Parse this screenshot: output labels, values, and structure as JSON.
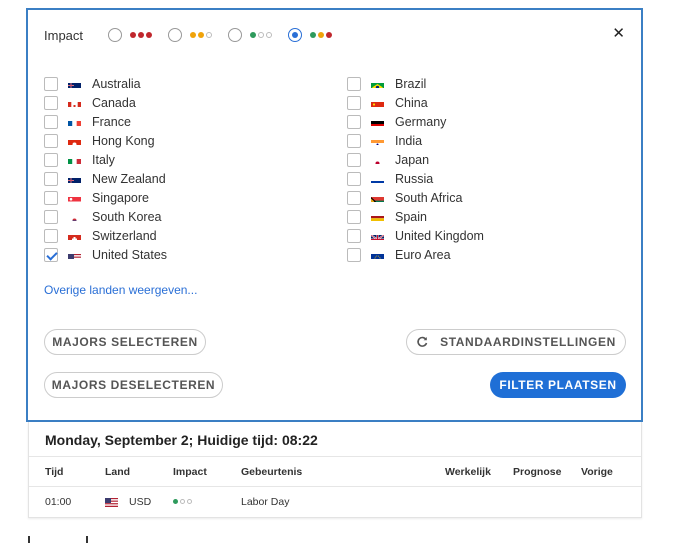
{
  "impact": {
    "label": "Impact",
    "options": [
      {
        "dots": [
          "#c0272d",
          "#c0272d",
          "#c0272d"
        ],
        "checked": false
      },
      {
        "dots": [
          "#f0a30a",
          "#f0a30a",
          "outline"
        ],
        "checked": false
      },
      {
        "dots": [
          "#2e9a5c",
          "outline",
          "outline"
        ],
        "checked": false
      },
      {
        "dots": [
          "#2e9a5c",
          "#f0a30a",
          "#c0272d"
        ],
        "checked": true
      }
    ]
  },
  "countries_left": [
    {
      "name": "Australia",
      "checked": false,
      "flag": "au"
    },
    {
      "name": "Canada",
      "checked": false,
      "flag": "ca"
    },
    {
      "name": "France",
      "checked": false,
      "flag": "fr"
    },
    {
      "name": "Hong Kong",
      "checked": false,
      "flag": "hk"
    },
    {
      "name": "Italy",
      "checked": false,
      "flag": "it"
    },
    {
      "name": "New Zealand",
      "checked": false,
      "flag": "nz"
    },
    {
      "name": "Singapore",
      "checked": false,
      "flag": "sg"
    },
    {
      "name": "South Korea",
      "checked": false,
      "flag": "kr"
    },
    {
      "name": "Switzerland",
      "checked": false,
      "flag": "ch"
    },
    {
      "name": "United States",
      "checked": true,
      "flag": "us"
    }
  ],
  "countries_right": [
    {
      "name": "Brazil",
      "checked": false,
      "flag": "br"
    },
    {
      "name": "China",
      "checked": false,
      "flag": "cn"
    },
    {
      "name": "Germany",
      "checked": false,
      "flag": "de"
    },
    {
      "name": "India",
      "checked": false,
      "flag": "in"
    },
    {
      "name": "Japan",
      "checked": false,
      "flag": "jp"
    },
    {
      "name": "Russia",
      "checked": false,
      "flag": "ru"
    },
    {
      "name": "South Africa",
      "checked": false,
      "flag": "za"
    },
    {
      "name": "Spain",
      "checked": false,
      "flag": "es"
    },
    {
      "name": "United Kingdom",
      "checked": false,
      "flag": "gb"
    },
    {
      "name": "Euro Area",
      "checked": false,
      "flag": "eu"
    }
  ],
  "more_link": "Overige landen weergeven...",
  "buttons": {
    "select_majors": "MAJORS SELECTEREN",
    "deselect_majors": "MAJORS DESELECTEREN",
    "defaults": "STANDAARDINSTELLINGEN",
    "apply": "FILTER PLAATSEN"
  },
  "results": {
    "date_heading": "Monday, September 2; Huidige tijd: 08:22",
    "columns": {
      "time": "Tijd",
      "country": "Land",
      "impact": "Impact",
      "event": "Gebeurtenis",
      "actual": "Werkelijk",
      "forecast": "Prognose",
      "previous": "Vorige"
    },
    "rows": [
      {
        "time": "01:00",
        "currency": "USD",
        "flag": "us",
        "impact_dots": [
          "#2e9a5c",
          "outline",
          "outline"
        ],
        "event": "Labor Day",
        "actual": "",
        "forecast": "",
        "previous": ""
      }
    ]
  },
  "colors": {
    "accent": "#1f6fd6",
    "panel_border": "#3b7fc4",
    "high": "#c0272d",
    "medium": "#f0a30a",
    "low": "#2e9a5c"
  }
}
